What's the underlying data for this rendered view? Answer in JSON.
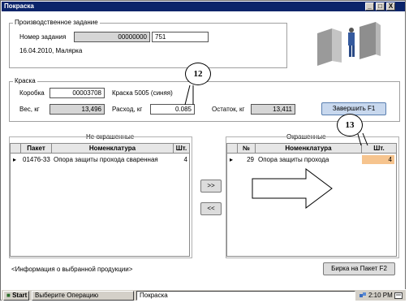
{
  "window": {
    "title": "Покраска",
    "controls": [
      "_",
      "□",
      "X"
    ]
  },
  "production_task": {
    "group_label": "Производственное задание",
    "number_label": "Номер задания",
    "number_code": "00000000",
    "number_value": "751",
    "date_line": "16.04.2010, Малярка"
  },
  "paint": {
    "group_label": "Краска",
    "box_label": "Коробка",
    "box_value": "00003708",
    "paint_name": "Краска 5005 (синяя)",
    "weight_label": "Вес, кг",
    "weight_value": "13,496",
    "consumption_label": "Расход, кг",
    "consumption_value": "0.085",
    "remainder_label": "Остаток, кг",
    "remainder_value": "13,411",
    "finish_button": "Завершить    F1"
  },
  "callouts": {
    "c12": "12",
    "c13": "13"
  },
  "unpainted": {
    "title": "Не окрашенные",
    "columns": [
      "Пакет",
      "Номенклатура",
      "Шт."
    ],
    "rows": [
      {
        "pointer": "▸",
        "package": "01476-33",
        "name": "Опора защиты прохода сваренная",
        "qty": "4"
      }
    ]
  },
  "painted": {
    "title": "Окрашенные",
    "columns": [
      "№",
      "Номенклатура",
      "Шт."
    ],
    "rows": [
      {
        "pointer": "▸",
        "num": "29",
        "name": "Опора защиты прохода",
        "qty": "4"
      }
    ]
  },
  "move_buttons": {
    "forward": ">>",
    "back": "<<"
  },
  "info_text": "<Информация о выбранной продукции>",
  "tag_button": "Бирка на Пакет   F2",
  "taskbar": {
    "start": "Start",
    "task1": "Выберите Операцию",
    "task2": "Покраска",
    "clock": "2:10 PM"
  },
  "colors": {
    "titlebar": "#0a246a",
    "highlight_cell": "#f6c48e",
    "finish_button": "#c8d8ee"
  }
}
